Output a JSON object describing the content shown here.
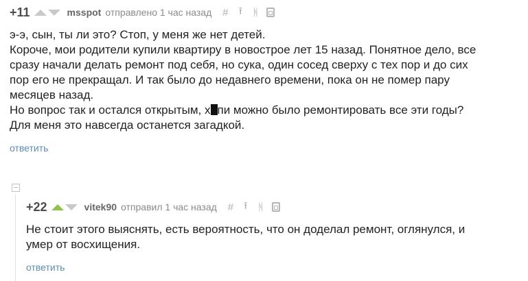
{
  "comment1": {
    "rating": "+11",
    "author": "msspot",
    "time": "отправлено 1 час назад",
    "actions": {
      "hash": "#",
      "up": "⭱",
      "branch": "ᚻ"
    },
    "text_lines": [
      "э-э, сын, ты ли это? Стоп, у меня же нет детей.",
      "Короче, мои родители купили квартиру в новострое лет 15 назад. Понятное дело, все",
      "сразу начали делать ремонт под себя, но сука, один сосед сверху с тех пор и до сих",
      "пор его не прекращал. И так было до недавнего времени, пока он не помер пару",
      "месяцев назад."
    ],
    "line6_prefix": "Но вопрос так и остался открытым, х",
    "line6_suffix": "пи можно было ремонтировать все эти годы?",
    "line7": "Для меня это навсегда останется загадкой.",
    "reply_label": "ответить"
  },
  "comment2": {
    "rating": "+22",
    "author": "vitek90",
    "time": "отправил 1 час назад",
    "actions": {
      "hash": "#",
      "up": "⭱",
      "branch": "ᚻ"
    },
    "text_lines": [
      "Не стоит этого выяснять, есть вероятность, что он доделал ремонт, оглянулся, и",
      "умер от восхищения."
    ],
    "reply_label": "ответить"
  },
  "colors": {
    "upvote_active": "#8fc34a",
    "link": "#5b8bb7"
  }
}
